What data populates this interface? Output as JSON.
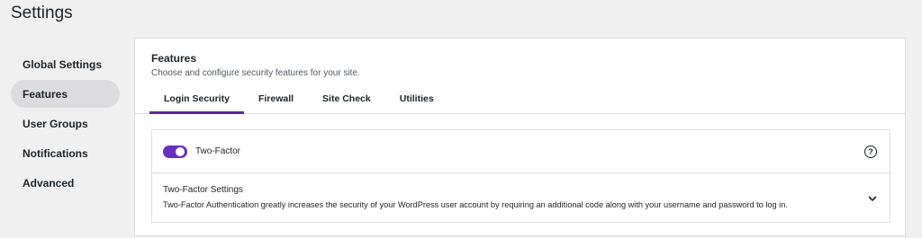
{
  "page": {
    "title": "Settings"
  },
  "sidebar": {
    "items": [
      {
        "label": "Global Settings",
        "active": false
      },
      {
        "label": "Features",
        "active": true
      },
      {
        "label": "User Groups",
        "active": false
      },
      {
        "label": "Notifications",
        "active": false
      },
      {
        "label": "Advanced",
        "active": false
      }
    ]
  },
  "main": {
    "title": "Features",
    "description": "Choose and configure security features for your site.",
    "tabs": [
      {
        "label": "Login Security",
        "active": true
      },
      {
        "label": "Firewall",
        "active": false
      },
      {
        "label": "Site Check",
        "active": false
      },
      {
        "label": "Utilities",
        "active": false
      }
    ],
    "feature": {
      "name": "Two-Factor",
      "enabled": true,
      "help_icon": "help-circle-icon",
      "settings_title": "Two-Factor Settings",
      "settings_description": "Two-Factor Authentication greatly increases the security of your WordPress user account by requiring an additional code along with your username and password to log in.",
      "expand_icon": "chevron-down-icon"
    }
  },
  "colors": {
    "accent": "#5b2a9e",
    "toggle_on": "#6b2ec2",
    "background": "#f0f0f1"
  }
}
